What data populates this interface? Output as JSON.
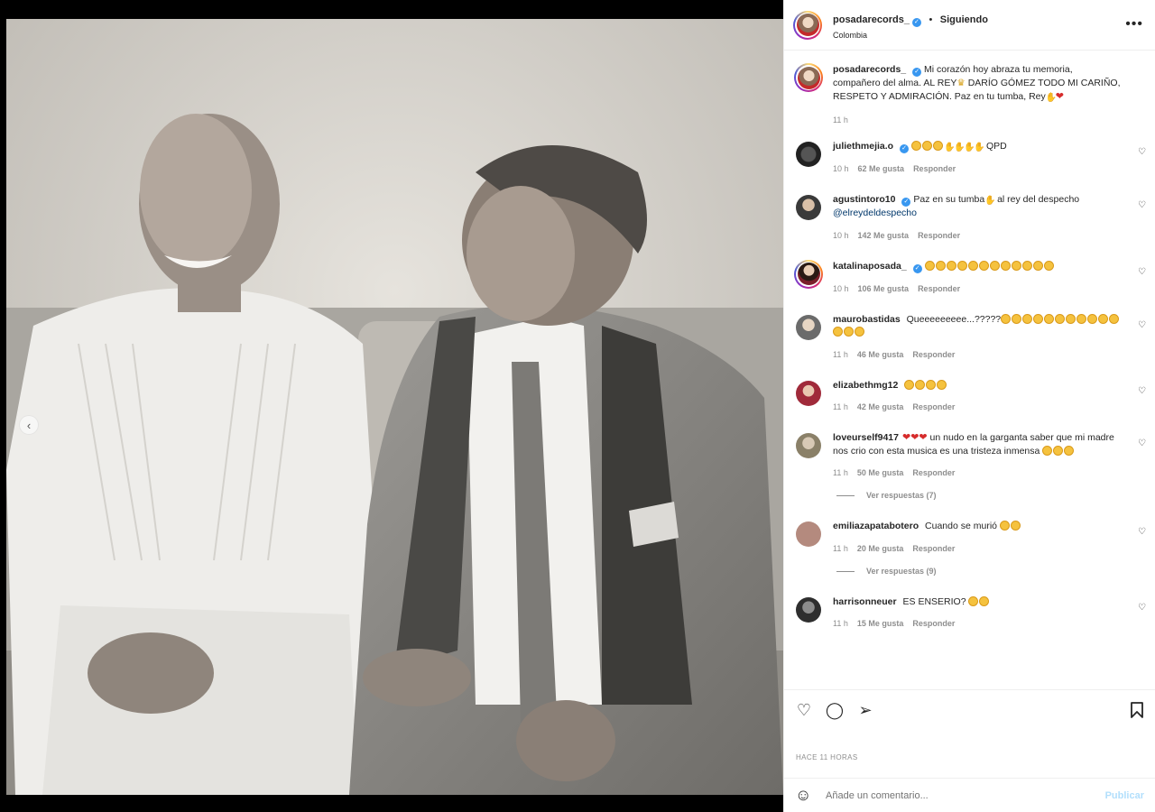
{
  "post": {
    "author": "posadarecords_",
    "follow_status": "Siguiendo",
    "separator": "•",
    "location": "Colombia",
    "more_icon": "more-horizontal-icon",
    "caption_part1": "Mi corazón hoy abraza tu memoria, compañero del alma. AL REY",
    "caption_part2": " DARÍO GÓMEZ TODO MI CARIÑO, RESPETO Y ADMIRACIÓN. Paz en tu tumba, Rey",
    "caption_time": "11 h",
    "timestamp": "HACE 11 HORAS"
  },
  "carousel": {
    "current": 2,
    "total": 2
  },
  "comments": [
    {
      "user": "juliethmejia.o",
      "verified": true,
      "text": "QPD",
      "time": "10 h",
      "likes": "62 Me gusta",
      "reply": "Responder"
    },
    {
      "user": "agustintoro10",
      "verified": true,
      "text": "Paz en su tumba",
      "text2": " al rey del despecho",
      "mention": "@elreydeldespecho",
      "time": "10 h",
      "likes": "142 Me gusta",
      "reply": "Responder"
    },
    {
      "user": "katalinaposada_",
      "verified": true,
      "time": "10 h",
      "likes": "106 Me gusta",
      "reply": "Responder"
    },
    {
      "user": "maurobastidas",
      "text": "Queeeeeeeee...?????",
      "time": "11 h",
      "likes": "46 Me gusta",
      "reply": "Responder"
    },
    {
      "user": "elizabethmg12",
      "time": "11 h",
      "likes": "42 Me gusta",
      "reply": "Responder"
    },
    {
      "user": "loveurself9417",
      "text": "un nudo en la garganta saber que mi madre nos crio con esta musica es una tristeza inmensa",
      "time": "11 h",
      "likes": "50 Me gusta",
      "reply": "Responder",
      "view_replies": "Ver respuestas (7)"
    },
    {
      "user": "emiliazapatabotero",
      "text": "Cuando se murió",
      "time": "11 h",
      "likes": "20 Me gusta",
      "reply": "Responder",
      "view_replies": "Ver respuestas (9)"
    },
    {
      "user": "harrisonneuer",
      "text": "ES ENSERIO?",
      "time": "11 h",
      "likes": "15 Me gusta",
      "reply": "Responder"
    }
  ],
  "composer": {
    "placeholder": "Añade un comentario...",
    "post_label": "Publicar"
  },
  "icons": {
    "like": "heart-icon",
    "comment": "comment-icon",
    "share": "send-icon",
    "save": "bookmark-icon",
    "emoji": "smiley-icon"
  },
  "colors": {
    "verified": "#3897f0",
    "link": "#00376b",
    "post_disabled": "#b2dffc"
  }
}
